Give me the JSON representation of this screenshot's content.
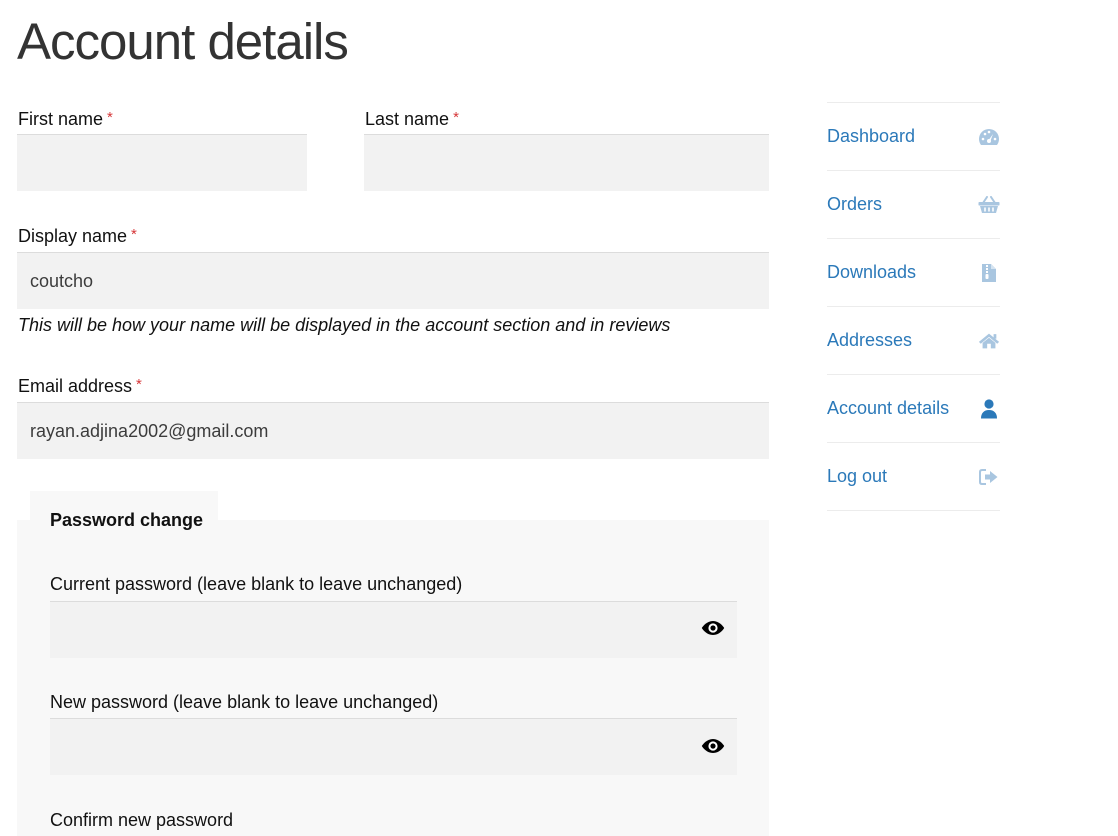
{
  "page_title": "Account details",
  "form": {
    "required_mark": "*",
    "first_name": {
      "label": "First name",
      "value": ""
    },
    "last_name": {
      "label": "Last name",
      "value": ""
    },
    "display_name": {
      "label": "Display name",
      "value": "coutcho",
      "hint": "This will be how your name will be displayed in the account section and in reviews"
    },
    "email": {
      "label": "Email address",
      "value": "rayan.adjina2002@gmail.com"
    },
    "password_change": {
      "legend": "Password change",
      "current": {
        "label": "Current password (leave blank to leave unchanged)",
        "value": "",
        "icon": "eye-icon"
      },
      "new": {
        "label": "New password (leave blank to leave unchanged)",
        "value": "",
        "icon": "eye-icon"
      },
      "confirm": {
        "label": "Confirm new password"
      }
    }
  },
  "nav": {
    "items": [
      {
        "label": "Dashboard",
        "icon": "dashboard-gauge-icon",
        "active": false
      },
      {
        "label": "Orders",
        "icon": "basket-icon",
        "active": false
      },
      {
        "label": "Downloads",
        "icon": "file-download-icon",
        "active": false
      },
      {
        "label": "Addresses",
        "icon": "home-icon",
        "active": false
      },
      {
        "label": "Account details",
        "icon": "user-icon",
        "active": true
      },
      {
        "label": "Log out",
        "icon": "logout-icon",
        "active": false
      }
    ]
  },
  "colors": {
    "link": "#2b79b9",
    "icon_inactive": "#a9c6e0",
    "icon_active": "#2b79b9",
    "required": "#d63638",
    "input_bg": "#f2f2f2"
  }
}
